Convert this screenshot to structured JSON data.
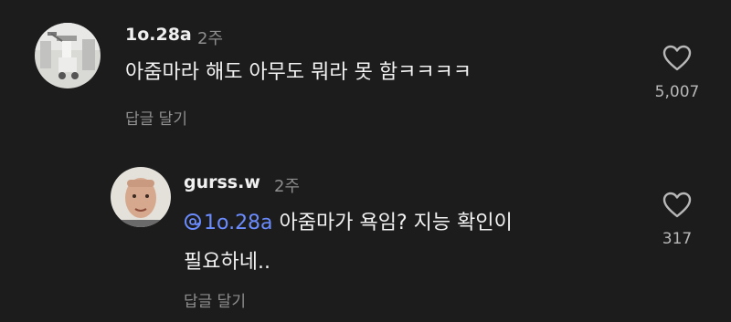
{
  "comments": [
    {
      "username": "1o.28a",
      "time": "2주",
      "text": "아줌마라 해도 아무도 뭐라 못 함ㅋㅋㅋㅋ",
      "reply_label": "답글 달기",
      "likes": "5,007",
      "avatar_icon": "avatar-photo-icon"
    },
    {
      "username": "gurss.w",
      "time": "2주",
      "mention": "1o.28a",
      "text_line1": "아줌마가 욕임? 지능 확인이",
      "text_line2": "필요하네..",
      "reply_label": "답글 달기",
      "likes": "317",
      "avatar_icon": "avatar-photo-icon"
    }
  ],
  "colors": {
    "background": "#1c1c1c",
    "text": "#f2f2f2",
    "muted": "#8e8e8e",
    "mention": "#6b8cff"
  }
}
